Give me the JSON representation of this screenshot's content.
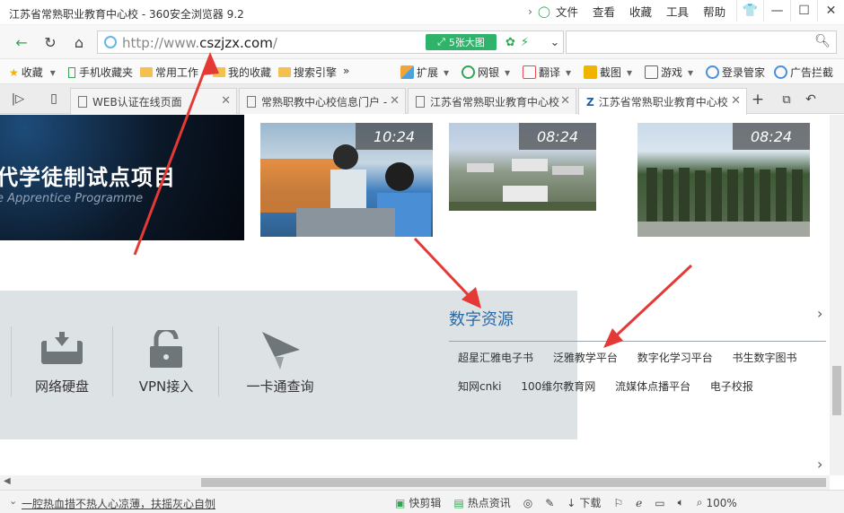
{
  "window": {
    "title": "江苏省常熟职业教育中心校 - 360安全浏览器 9.2",
    "menus": [
      "文件",
      "查看",
      "收藏",
      "工具",
      "帮助"
    ]
  },
  "addressbar": {
    "url_prefix": "http://www.",
    "url_domain": "cszjzx.com",
    "url_suffix": "/",
    "image_button": "5张大图"
  },
  "favorites": {
    "items": [
      "收藏",
      "手机收藏夹",
      "常用工作",
      "我的收藏",
      "搜索引擎"
    ],
    "more": "»",
    "extensions": [
      "扩展",
      "网银",
      "翻译",
      "截图",
      "游戏",
      "登录管家",
      "广告拦截"
    ]
  },
  "tabs": [
    {
      "label": "WEB认证在线页面",
      "active": false
    },
    {
      "label": "常熟职教中心校信息门户 -",
      "active": false
    },
    {
      "label": "江苏省常熟职业教育中心校",
      "active": false
    },
    {
      "label": "江苏省常熟职业教育中心校",
      "active": true
    }
  ],
  "page": {
    "banner": {
      "title": "代学徒制试点项目",
      "subtitle": "e Apprentice Programme"
    },
    "thumbnails": [
      {
        "time": "10:24",
        "desc": "students-robot-arm"
      },
      {
        "time": "08:24",
        "desc": "campus-aerial"
      },
      {
        "time": "08:24",
        "desc": "military-training"
      }
    ],
    "services": [
      "网络硬盘",
      "VPN接入",
      "一卡通查询"
    ],
    "digital": {
      "heading": "数字资源",
      "row1": [
        "超星汇雅电子书",
        "泛雅教学平台",
        "数字化学习平台",
        "书生数字图书"
      ],
      "row2": [
        "知网cnki",
        "100维尔教育网",
        "流媒体点播平台",
        "电子校报"
      ]
    }
  },
  "statusbar": {
    "news": "一腔热血措不热人心凉薄，扶摇灰心自刎",
    "items": [
      "快剪辑",
      "热点资讯",
      "下载"
    ],
    "zoom": "100%"
  },
  "colors": {
    "accent_green": "#2fb36a",
    "heading_blue": "#2b6aa6",
    "annotation_red": "#e53935"
  }
}
